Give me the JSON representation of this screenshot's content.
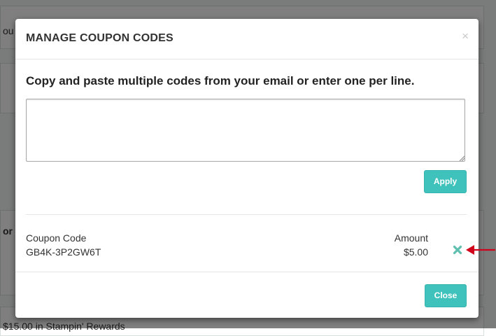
{
  "background": {
    "partial_text_1": "ou",
    "partial_text_2": "or",
    "rewards_text": "$15.00 in Stampin' Rewards"
  },
  "modal": {
    "title": "MANAGE COUPON CODES",
    "close_symbol": "×",
    "instruction": "Copy and paste multiple codes from your email or enter one per line.",
    "textarea_value": "",
    "apply_label": "Apply",
    "table": {
      "headers": {
        "code": "Coupon Code",
        "amount": "Amount"
      },
      "rows": [
        {
          "code": "GB4K-3P2GW6T",
          "amount": "$5.00",
          "remove_icon": "x-icon"
        }
      ]
    },
    "close_label": "Close"
  },
  "colors": {
    "accent": "#3fc1bc",
    "remove_icon": "#5fc0b0",
    "annotation_arrow": "#d0021b"
  }
}
